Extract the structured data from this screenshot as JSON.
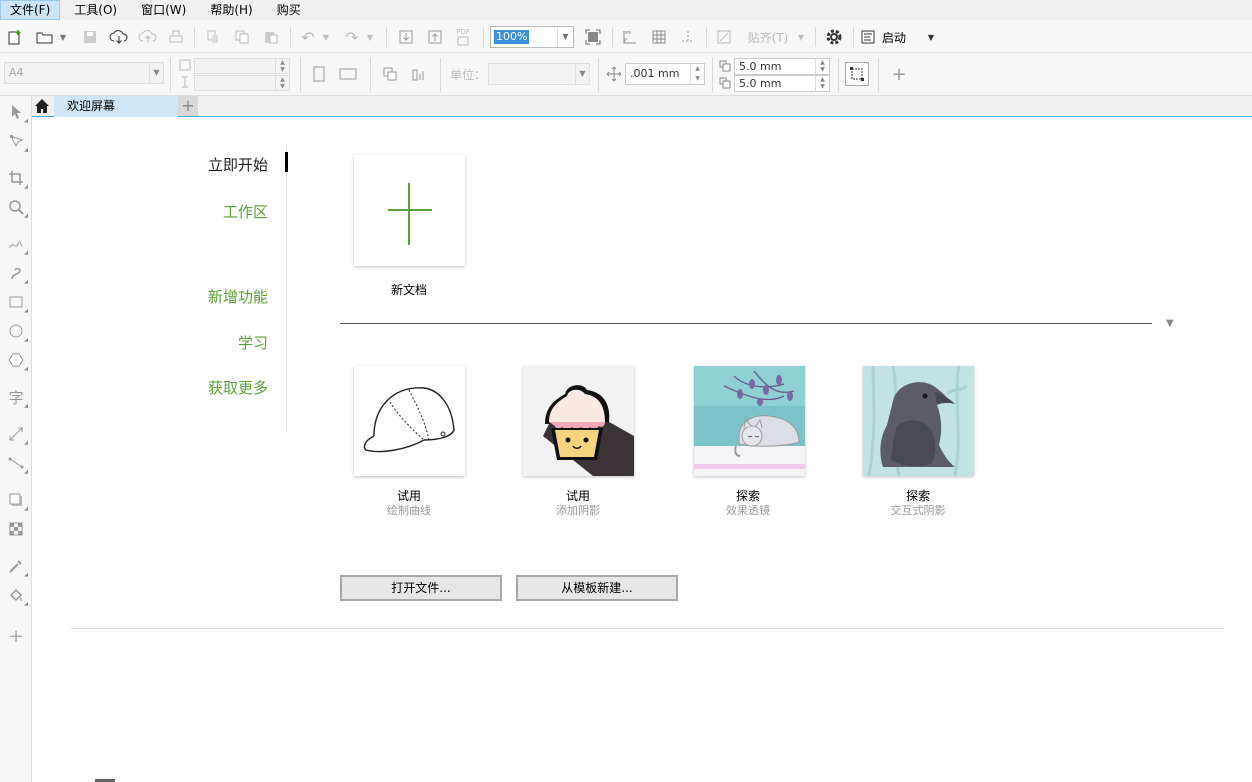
{
  "menu": [
    "文件(F)",
    "工具(O)",
    "窗口(W)",
    "帮助(H)",
    "购买"
  ],
  "toolbar": {
    "zoom_value": "100%",
    "snap_label": "贴齐(T)",
    "launch_label": "启动",
    "pdf_label": "PDF"
  },
  "propbar": {
    "page_size": "A4",
    "unit_label": "单位：",
    "nudge": ".001 mm",
    "dup_x": "5.0 mm",
    "dup_y": "5.0 mm"
  },
  "tabs": {
    "welcome": "欢迎屏幕"
  },
  "nav": {
    "items": [
      "立即开始",
      "工作区",
      "新增功能",
      "学习",
      "获取更多"
    ]
  },
  "new_document": {
    "label": "新文档"
  },
  "samples": [
    {
      "title": "试用",
      "subtitle": "绘制曲线",
      "icon": "baseball-cap"
    },
    {
      "title": "试用",
      "subtitle": "添加阴影",
      "icon": "cupcake"
    },
    {
      "title": "探索",
      "subtitle": "效果透镜",
      "icon": "sleeping-cat"
    },
    {
      "title": "探索",
      "subtitle": "交互式阴影",
      "icon": "raven"
    }
  ],
  "actions": {
    "open_file": "打开文件...",
    "new_from_template": "从模板新建..."
  },
  "colors": {
    "accent_green": "#5ea03a",
    "tab_active": "#cfe6f6",
    "tab_underline": "#3fa9d6",
    "zoom_highlight": "#3b8fdb"
  }
}
